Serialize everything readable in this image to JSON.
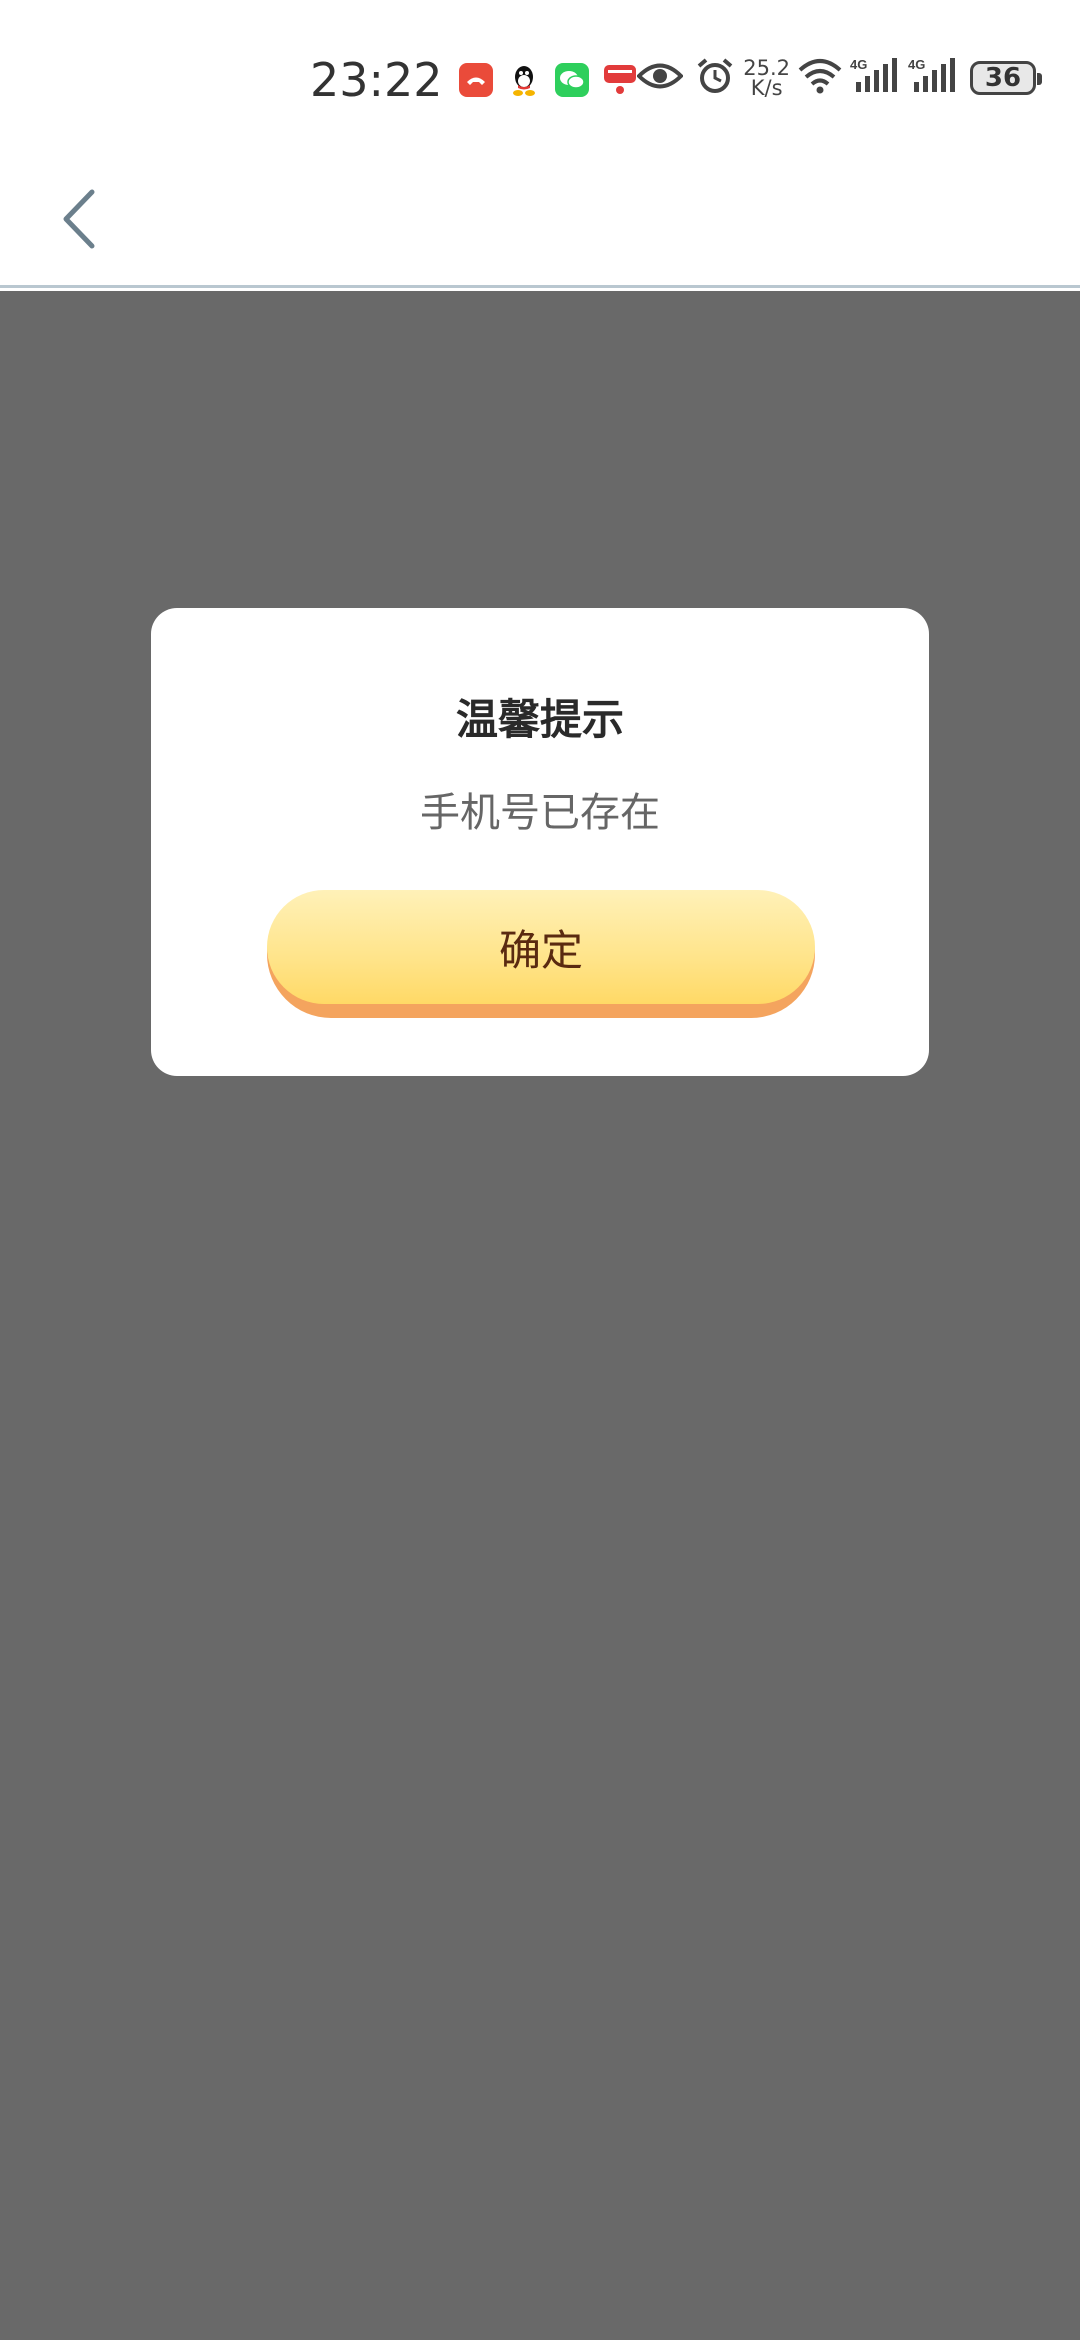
{
  "status_bar": {
    "time": "23:22",
    "net_speed_value": "25.2",
    "net_speed_unit": "K/s",
    "signal1_label": "4G",
    "signal2_label": "4G",
    "battery": "36",
    "app_icons": [
      "kge-icon",
      "qq-icon",
      "wechat-icon",
      "red-app-icon"
    ],
    "system_icons": [
      "eye-icon",
      "alarm-icon",
      "wifi-icon",
      "signal-icon",
      "signal-icon",
      "battery-icon"
    ]
  },
  "header": {
    "back_icon": "chevron-left-icon"
  },
  "dialog": {
    "title": "温馨提示",
    "message": "手机号已存在",
    "confirm_label": "确定"
  },
  "colors": {
    "overlay": "#696969",
    "button_top": "#fff1b8",
    "button_bottom": "#ffd966",
    "button_shadow": "#f4a45e",
    "button_text": "#5a2a10"
  }
}
